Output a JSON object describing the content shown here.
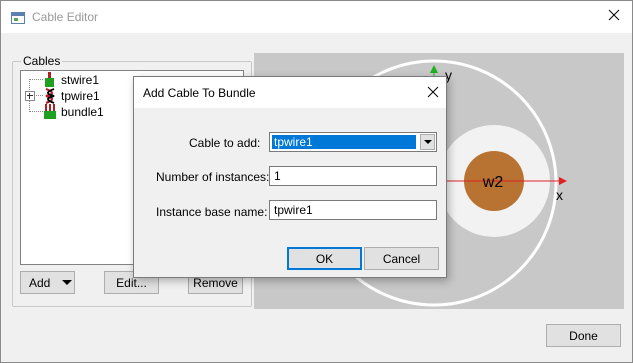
{
  "window": {
    "title": "Cable Editor"
  },
  "cables_group": {
    "label": "Cables",
    "items": [
      {
        "label": "stwire1",
        "icon": "single-wire-cable-icon",
        "expandable": false
      },
      {
        "label": "tpwire1",
        "icon": "twisted-pair-cable-icon",
        "expandable": true
      },
      {
        "label": "bundle1",
        "icon": "bundle-cable-icon",
        "expandable": false
      }
    ],
    "add_label": "Add",
    "edit_label": "Edit...",
    "remove_label": "Remove"
  },
  "canvas": {
    "axis_y": "y",
    "axis_x": "x",
    "wire_label": "w2",
    "colors": {
      "background": "#c8c8c8",
      "ring": "#ffffff",
      "conductor": "#b87333",
      "axis_x": "#e02020",
      "axis_y": "#20b020"
    }
  },
  "done_label": "Done",
  "dialog": {
    "title": "Add Cable To Bundle",
    "cable_label": "Cable to add:",
    "cable_value": "tpwire1",
    "instances_label": "Number of instances:",
    "instances_value": "1",
    "basename_label": "Instance base name:",
    "basename_value": "tpwire1",
    "ok_label": "OK",
    "cancel_label": "Cancel"
  }
}
